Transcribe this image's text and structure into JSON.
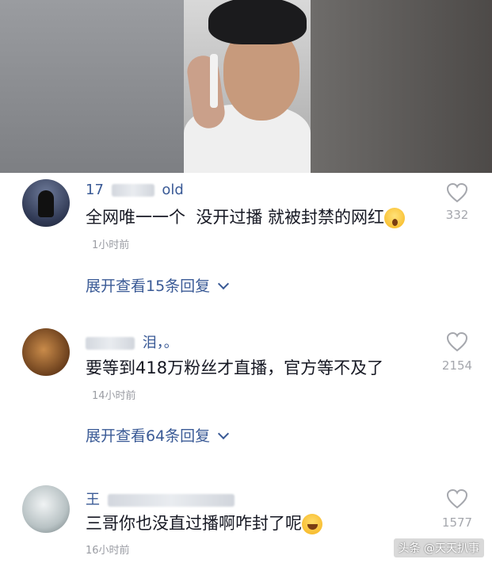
{
  "comments": [
    {
      "username_visible": "17",
      "username_suffix": "old",
      "text": "全网唯一一个  没开过播 就被封禁的网红",
      "time": "1小时前",
      "likes": "332",
      "expand": "展开查看15条回复"
    },
    {
      "username_suffix": "泪，。",
      "text": "要等到418万粉丝才直播，官方等不及了",
      "time": "14小时前",
      "likes": "2154",
      "expand": "展开查看64条回复"
    },
    {
      "username_visible": "王",
      "text": "三哥你也没直过播啊咋封了呢",
      "time": "16小时前",
      "likes": "1577"
    }
  ],
  "watermark": "头条 @天天扒事",
  "colors": {
    "accent": "#3a5a96",
    "muted": "#a5a7ad",
    "text": "#161823"
  }
}
